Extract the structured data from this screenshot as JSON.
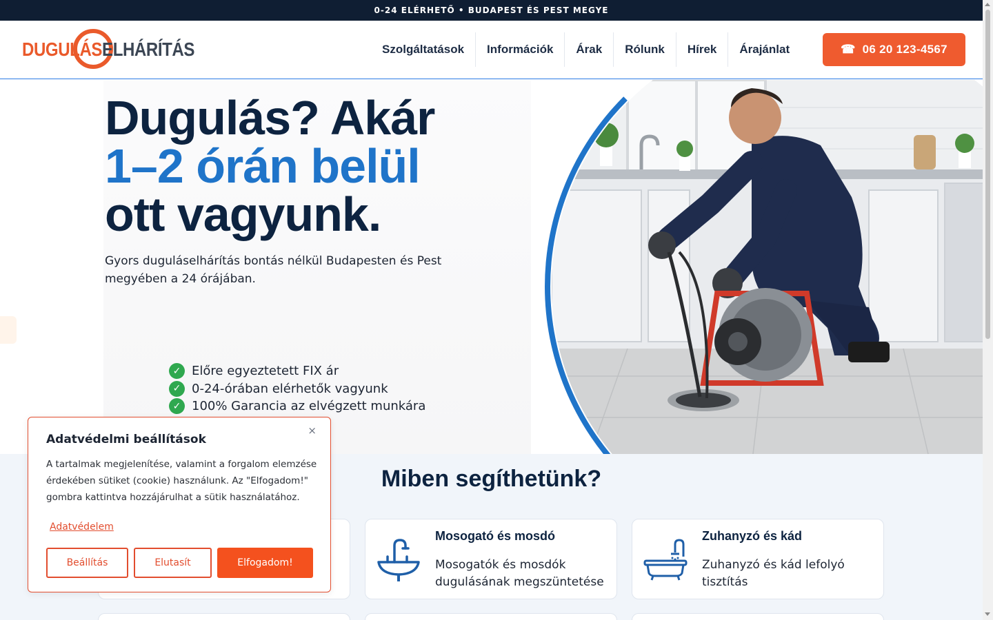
{
  "topbar": {
    "text": "0-24 ELÉRHETŐ • BUDAPEST ÉS PEST MEGYE"
  },
  "header": {
    "logo": {
      "part1": "DUGULÁS",
      "part2": "ELHÁRÍTÁS"
    },
    "nav": [
      {
        "label": "Szolgáltatások"
      },
      {
        "label": "Információk"
      },
      {
        "label": "Árak"
      },
      {
        "label": "Rólunk"
      },
      {
        "label": "Hírek"
      },
      {
        "label": "Árajánlat"
      }
    ],
    "call_button": {
      "icon": "phone-icon",
      "label": "06 20 123-4567"
    }
  },
  "hero": {
    "headline_line1": "Dugulás? Akár",
    "headline_line2": "1–2 órán belül",
    "headline_line3": "ott vagyunk.",
    "subtitle": "Gyors duguláselhárítás bontás nélkül Budapesten és Pest megyében a 24 órájában.",
    "features": [
      {
        "text": "Előre egyeztetett FIX ár"
      },
      {
        "text": "0-24-órában elérhetők vagyunk"
      },
      {
        "text": "100% Garancia az elvégzett munkára"
      }
    ]
  },
  "services": {
    "title": "Miben segíthetünk?",
    "cards": [
      {
        "title": "Mosogató és mosdó",
        "desc": "Mosogatók és mosdók dugulásának megszüntetése",
        "icon": "sink-icon"
      },
      {
        "title": "Zuhanyzó és kád",
        "desc": "Zuhanyzó és kád lefolyó tisztítás",
        "icon": "bathtub-icon"
      }
    ]
  },
  "cookie": {
    "title": "Adatvédelmi beállítások",
    "text": "A tartalmak megjelenítése, valamint a forgalom elemzése érdekében sütiket (cookie) használunk. Az \"Elfogadom!\" gombra kattintva hozzájárulhat a sütik használatához.",
    "link": "Adatvédelem",
    "buttons": {
      "settings": "Beállítás",
      "reject": "Elutasít",
      "accept": "Elfogadom!"
    },
    "close": "×"
  },
  "colors": {
    "accent": "#ef5b2f",
    "brand_blue": "#1f74c9",
    "navy": "#0d2340",
    "check_green": "#2fa84f"
  }
}
